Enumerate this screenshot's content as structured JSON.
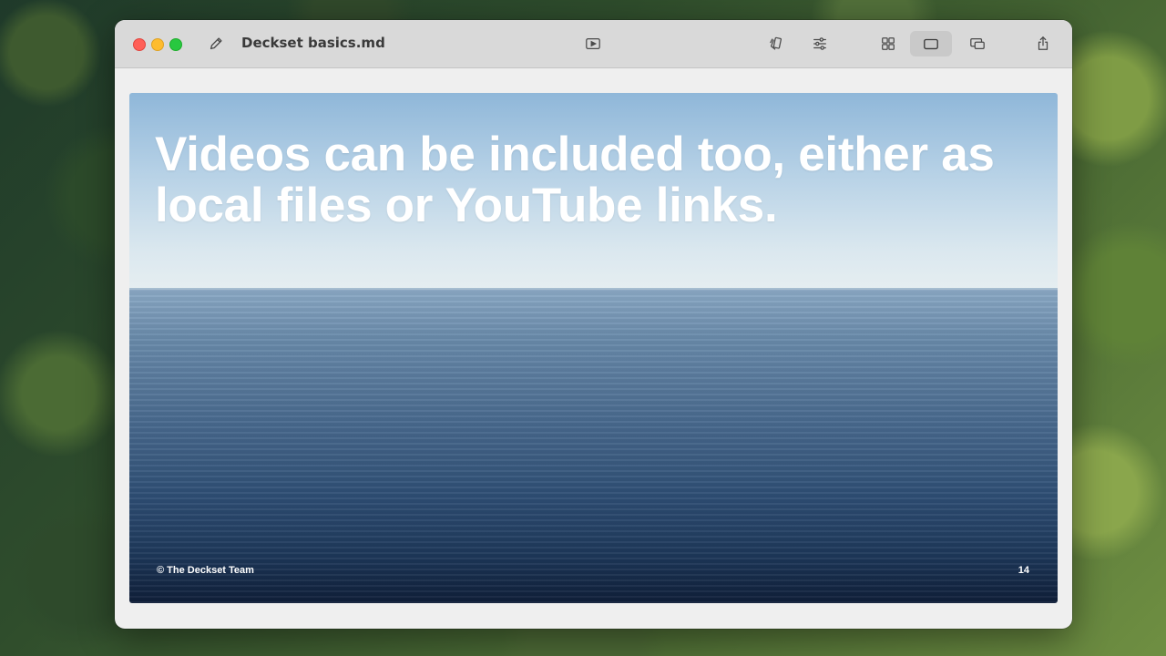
{
  "window": {
    "title": "Deckset basics.md"
  },
  "toolbar": {
    "icons": [
      "pencil-icon",
      "play-icon",
      "theme-icon",
      "sliders-icon",
      "grid-icon",
      "single-slide-icon",
      "presenter-icon",
      "share-icon"
    ],
    "active_view": "single-slide"
  },
  "slide": {
    "title": "Videos can be included too, either as local files or YouTube links.",
    "footer": "© The Deckset Team",
    "page_number": "14"
  },
  "colors": {
    "close": "#ff5f57",
    "minimize": "#febc2e",
    "maximize": "#28c840",
    "titlebar": "#d9d9d9",
    "slide_text": "#ffffff"
  }
}
